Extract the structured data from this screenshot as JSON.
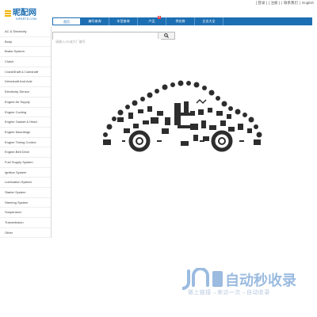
{
  "top_links": {
    "register": "[ 登录 ]",
    "login": "[ 注册 ]",
    "sep": "|",
    "contact": "联系我们",
    "english": "English"
  },
  "logo": {
    "name": "昵配网",
    "sub": "NIPARTS.COM"
  },
  "nav": {
    "tabs": [
      {
        "label": "首页",
        "active": true
      },
      {
        "label": "编号查询"
      },
      {
        "label": "车型查询"
      },
      {
        "label": "产品",
        "badge": "新"
      },
      {
        "label": "供应商"
      },
      {
        "label": "企业大全"
      }
    ]
  },
  "search": {
    "placeholder": "请输入OE或大厂编号",
    "button_icon": "search-icon"
  },
  "sidebar": {
    "items": [
      "AC & Electricity",
      "Body",
      "Brake System",
      "Clutch",
      "CrankShaft & Camshaft",
      "Driveshaft And Axle",
      "Electricity-Sensor",
      "Engine Air Supply",
      "Engine Cooling",
      "Engine Gasket & Head",
      "Engine Mountings",
      "Engine Timing Control",
      "Engine-Belt Drive",
      "Fuel Supply System",
      "Ignition System",
      "Lubrication System",
      "Starter System",
      "Steering System",
      "Suspension",
      "Transmission",
      "Other"
    ]
  },
  "watermark": {
    "line2": "自动秒收录",
    "line3": "做上链接→来访一次→自动收录"
  },
  "colors": {
    "brand": "#1d6fb3",
    "logo_accent": "#f0b400",
    "badge": "#e23b3b"
  }
}
